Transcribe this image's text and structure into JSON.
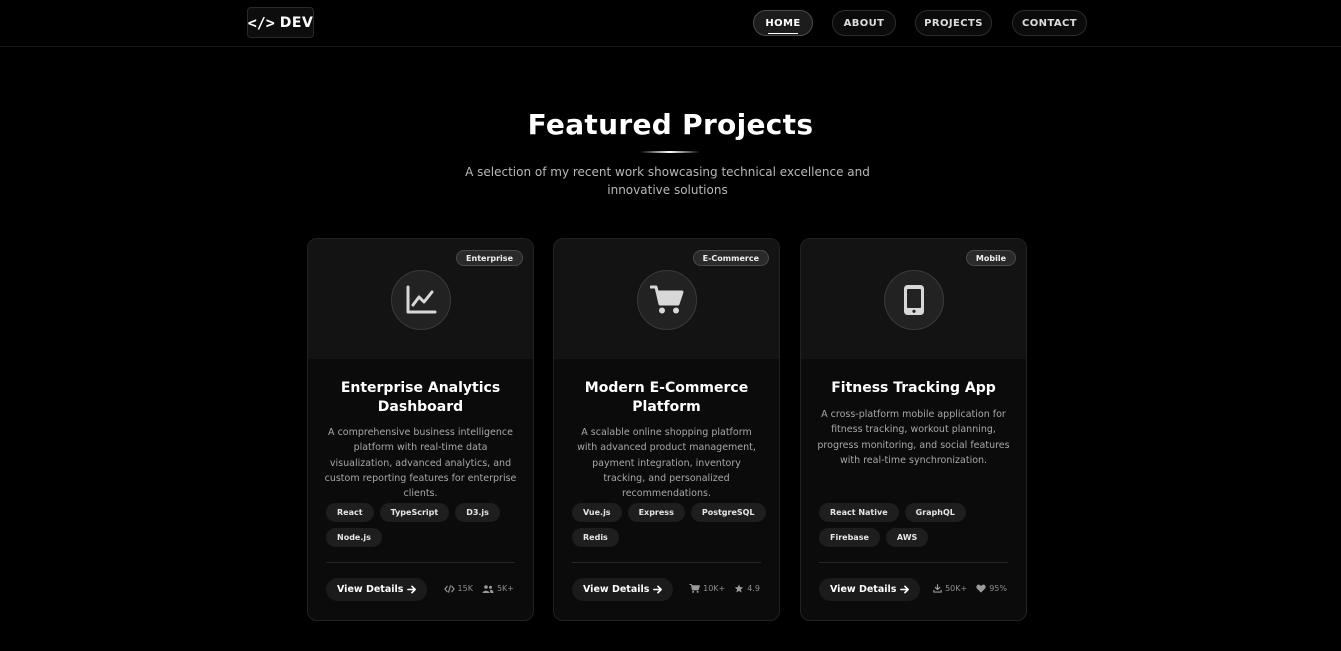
{
  "nav": {
    "logo_code": "</>",
    "logo_text": "DEV",
    "links": [
      "HOME",
      "ABOUT",
      "PROJECTS",
      "CONTACT"
    ]
  },
  "section": {
    "title": "Featured Projects",
    "subtitle": "A selection of my recent work showcasing technical excellence and innovative solutions"
  },
  "cards": [
    {
      "badge": "Enterprise",
      "icon": "chart-line-icon",
      "title": "Enterprise Analytics Dashboard",
      "description": "A comprehensive business intelligence platform with real-time data visualization, advanced analytics, and custom reporting features for enterprise clients.",
      "tags": [
        "React",
        "TypeScript",
        "D3.js",
        "Node.js"
      ],
      "button": "View Details",
      "stats": [
        {
          "icon": "code-icon",
          "value": "15K"
        },
        {
          "icon": "users-icon",
          "value": "5K+"
        }
      ]
    },
    {
      "badge": "E-Commerce",
      "icon": "shopping-cart-icon",
      "title": "Modern E-Commerce Platform",
      "description": "A scalable online shopping platform with advanced product management, payment integration, inventory tracking, and personalized recommendations.",
      "tags": [
        "Vue.js",
        "Express",
        "PostgreSQL",
        "Redis"
      ],
      "button": "View Details",
      "stats": [
        {
          "icon": "cart-icon",
          "value": "10K+"
        },
        {
          "icon": "star-icon",
          "value": "4.9"
        }
      ]
    },
    {
      "badge": "Mobile",
      "icon": "mobile-phone-icon",
      "title": "Fitness Tracking App",
      "description": "A cross-platform mobile application for fitness tracking, workout planning, progress monitoring, and social features with real-time synchronization.",
      "tags": [
        "React Native",
        "GraphQL",
        "Firebase",
        "AWS"
      ],
      "button": "View Details",
      "stats": [
        {
          "icon": "download-icon",
          "value": "50K+"
        },
        {
          "icon": "heart-icon",
          "value": "95%"
        }
      ]
    }
  ]
}
